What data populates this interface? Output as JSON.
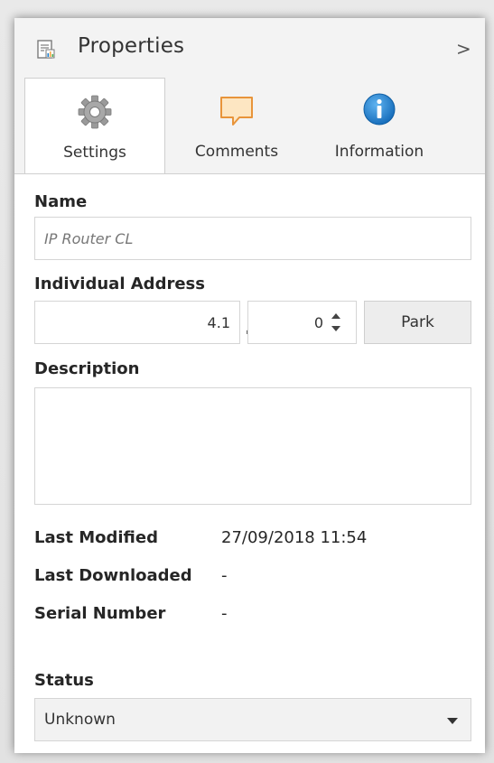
{
  "header": {
    "title": "Properties",
    "chevron": ">"
  },
  "tabs": [
    {
      "label": "Settings",
      "icon": "gear-icon",
      "active": true
    },
    {
      "label": "Comments",
      "icon": "comment-bubble-icon",
      "active": false
    },
    {
      "label": "Information",
      "icon": "info-icon",
      "active": false
    }
  ],
  "form": {
    "name_label": "Name",
    "name_value": "IP Router CL",
    "address_label": "Individual Address",
    "address_main": "4.1",
    "address_separator": ".",
    "address_device": "0",
    "park_label": "Park",
    "description_label": "Description",
    "description_value": ""
  },
  "info": {
    "last_modified_label": "Last Modified",
    "last_modified_value": "27/09/2018 11:54",
    "last_downloaded_label": "Last Downloaded",
    "last_downloaded_value": "-",
    "serial_number_label": "Serial Number",
    "serial_number_value": "-"
  },
  "status": {
    "label": "Status",
    "value": "Unknown"
  },
  "colors": {
    "info_blue": "#1e7fd1",
    "comment_orange": "#f2a74b",
    "comment_fill": "#fde6c2",
    "gear_gray": "#8f8f8f",
    "accent_red": "#d04040"
  }
}
